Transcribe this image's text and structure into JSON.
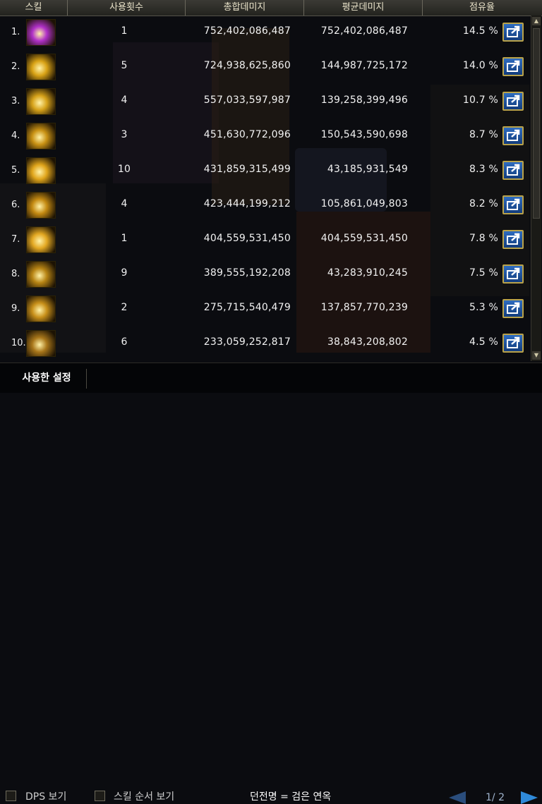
{
  "header": {
    "skill": "스킬",
    "uses": "사용횟수",
    "total": "총합데미지",
    "avg": "평균데미지",
    "share": "점유율"
  },
  "rows": [
    {
      "rank": "1.",
      "uses": "1",
      "total": "752,402,086,487",
      "avg": "752,402,086,487",
      "share": "14.5 %",
      "icon_color": "#b030c8"
    },
    {
      "rank": "2.",
      "uses": "5",
      "total": "724,938,625,860",
      "avg": "144,987,725,172",
      "share": "14.0 %",
      "icon_color": "#d9a316"
    },
    {
      "rank": "3.",
      "uses": "4",
      "total": "557,033,597,987",
      "avg": "139,258,399,496",
      "share": "10.7 %",
      "icon_color": "#d6a21a"
    },
    {
      "rank": "4.",
      "uses": "3",
      "total": "451,630,772,096",
      "avg": "150,543,590,698",
      "share": "8.7 %",
      "icon_color": "#c99214"
    },
    {
      "rank": "5.",
      "uses": "10",
      "total": "431,859,315,499",
      "avg": "43,185,931,549",
      "share": "8.3 %",
      "icon_color": "#e0a51b"
    },
    {
      "rank": "6.",
      "uses": "4",
      "total": "423,444,199,212",
      "avg": "105,861,049,803",
      "share": "8.2 %",
      "icon_color": "#c48a12"
    },
    {
      "rank": "7.",
      "uses": "1",
      "total": "404,559,531,450",
      "avg": "404,559,531,450",
      "share": "7.8 %",
      "icon_color": "#e3a822"
    },
    {
      "rank": "8.",
      "uses": "9",
      "total": "389,555,192,208",
      "avg": "43,283,910,245",
      "share": "7.5 %",
      "icon_color": "#b78414"
    },
    {
      "rank": "9.",
      "uses": "2",
      "total": "275,715,540,479",
      "avg": "137,857,770,239",
      "share": "5.3 %",
      "icon_color": "#c8901a"
    },
    {
      "rank": "10.",
      "uses": "6",
      "total": "233,059,252,817",
      "avg": "38,843,208,802",
      "share": "4.5 %",
      "icon_color": "#a8761a"
    }
  ],
  "settings_tab": "사용한 설정",
  "footer": {
    "dps_label": "DPS 보기",
    "order_label": "스킬 순서 보기",
    "dungeon": "던전명 = 검은 연옥",
    "page": "1/ 2"
  }
}
